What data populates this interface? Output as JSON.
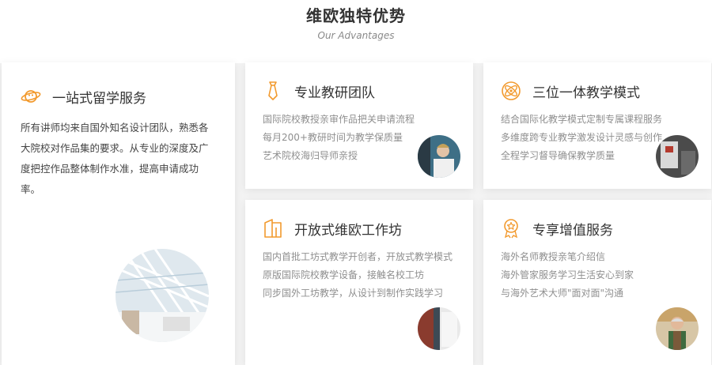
{
  "header": {
    "title": "维欧独特优势",
    "subtitle": "Our Advantages"
  },
  "colors": {
    "accent": "#f29a2e"
  },
  "cards": [
    {
      "title": "一站式留学服务",
      "icon": "planet-icon",
      "desc": "所有讲师均来自国外知名设计团队，熟悉各大院校对作品集的要求。从专业的深度及广度把控作品整体制作水准，提高申请成功率。"
    },
    {
      "title": "专业教研团队",
      "icon": "tie-icon",
      "lines": [
        "国际院校教授亲审作品把关申请流程",
        "每月200+教研时间为教学保质量",
        "艺术院校海归导师亲授"
      ]
    },
    {
      "title": "三位一体教学模式",
      "icon": "atom-icon",
      "lines": [
        "结合国际化教学模式定制专属课程服务",
        "多维度跨专业教学激发设计灵感与创作",
        "全程学习督导确保教学质量"
      ]
    },
    {
      "title": "开放式维欧工作坊",
      "icon": "workshop-icon",
      "lines": [
        "国内首批工坊式教学开创者，开放式教学模式",
        "原版国际院校教学设备，接触名校工坊",
        "同步国外工坊教学，从设计到制作实践学习"
      ]
    },
    {
      "title": "专享增值服务",
      "icon": "medal-icon",
      "lines": [
        "海外名师教授亲笔介绍信",
        "海外管家服务学习生活安心到家",
        "与海外艺术大师\"面对面\"沟通"
      ]
    }
  ]
}
